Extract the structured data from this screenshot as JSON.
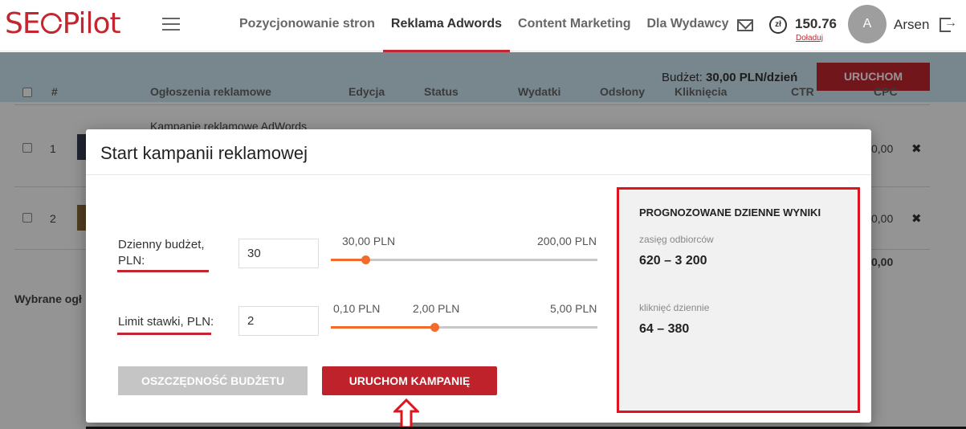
{
  "header": {
    "logo_text": "SEOPilot",
    "nav": [
      {
        "label": "Pozycjonowanie stron",
        "active": false
      },
      {
        "label": "Reklama Adwords",
        "active": true
      },
      {
        "label": "Content Marketing",
        "active": false
      },
      {
        "label": "Dla Wydawcy",
        "active": false
      }
    ],
    "currency_icon_text": "zł",
    "balance": "150.76",
    "topup_label": "Doładuj",
    "avatar_initial": "A",
    "user_name": "Arsen"
  },
  "background": {
    "budget_label": "Budżet:",
    "budget_value": "30,00 PLN/dzień",
    "run_button": "URUCHOM",
    "table_headers": [
      "#",
      "Ogłoszenia reklamowe",
      "Edycja",
      "Status",
      "Wydatki",
      "Odsłony",
      "Kliknięcia",
      "CTR",
      "CPC"
    ],
    "rows": [
      {
        "index": "1",
        "title": "Kampanie reklamowe AdWords",
        "value": "0,00"
      },
      {
        "index": "2",
        "title": "",
        "value": "0,00"
      }
    ],
    "total_value": "0,00",
    "selected_label": "Wybrane ogł"
  },
  "modal": {
    "title": "Start kampanii reklamowej",
    "budget": {
      "label_line1": "Dzienny budżet,",
      "label_line2": "PLN:",
      "value": "30",
      "current_label": "30,00 PLN",
      "max_label": "200,00 PLN",
      "level": 0.13
    },
    "bid": {
      "label": "Limit stawki, PLN:",
      "value": "2",
      "min_label": "0,10 PLN",
      "current_label": "2,00 PLN",
      "max_label": "5,00 PLN",
      "level": 0.39
    },
    "save_button": "OSZCZĘDNOŚĆ BUDŻETU",
    "launch_button": "URUCHOM KAMPANIĘ",
    "results": {
      "title": "PROGNOZOWANE DZIENNE WYNIKI",
      "reach_label": "zasięg odbiorców",
      "reach_value": "620 – 3 200",
      "clicks_label": "kliknięć dziennie",
      "clicks_value": "64 – 380"
    }
  },
  "colors": {
    "brand_red": "#c3262f",
    "slider_orange": "#f26b2a",
    "highlight_red": "#e0141e",
    "header_band_blue": "#cfe7f3"
  },
  "icons": [
    "menu-icon",
    "mail-icon",
    "currency-icon",
    "logout-icon",
    "remove-icon",
    "up-arrow-icon"
  ]
}
